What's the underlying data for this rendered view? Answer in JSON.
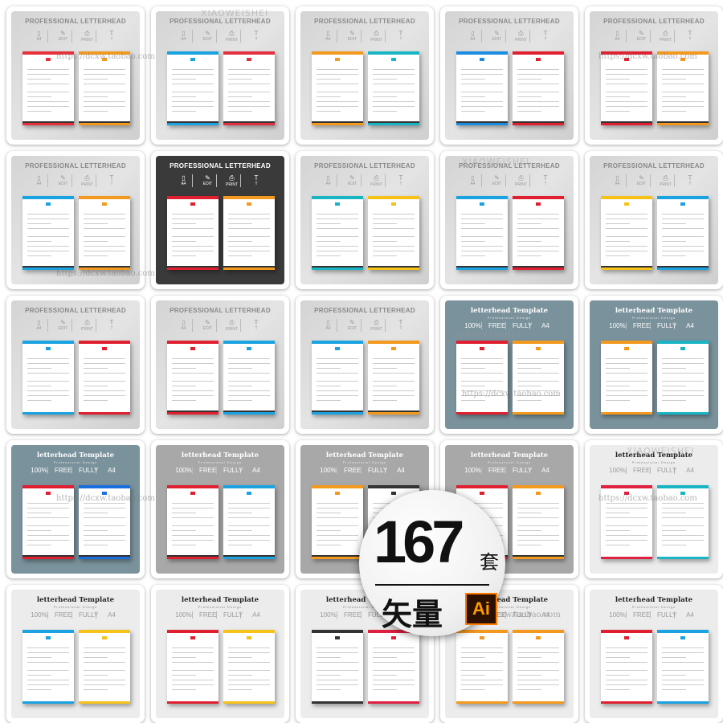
{
  "watermark": {
    "url": "https://dcxw.taobao.com",
    "brand": "XIAOWEISHEI"
  },
  "header_variants": {
    "pro": {
      "title": "PROFESSIONAL LETTERHEAD",
      "icons": [
        {
          "icon": "document-icon",
          "label": "A4"
        },
        {
          "icon": "pencil-icon",
          "label": "EDIT"
        },
        {
          "icon": "printer-icon",
          "label": "PRINT"
        },
        {
          "icon": "font-icon",
          "label": "T"
        }
      ]
    },
    "tpl": {
      "title": "letterhead Template",
      "subtitle": "Professional Design",
      "badges": [
        "100%",
        "FREE",
        "FULLY",
        "A4"
      ]
    }
  },
  "tiles": [
    {
      "variant": "pro",
      "bg": "light",
      "a": "#e8303a",
      "b": "#f39a1e",
      "foot": "#333"
    },
    {
      "variant": "pro",
      "bg": "light",
      "a": "#1aa3e0",
      "b": "#e23040",
      "foot": "#333"
    },
    {
      "variant": "pro",
      "bg": "light",
      "a": "#f39a1e",
      "b": "#1ab5c4",
      "foot": "#333"
    },
    {
      "variant": "pro",
      "bg": "light",
      "a": "#1a8de0",
      "b": "#e02030",
      "foot": "#333"
    },
    {
      "variant": "pro",
      "bg": "light",
      "a": "#e02030",
      "b": "#f39a1e",
      "foot": "#333"
    },
    {
      "variant": "pro",
      "bg": "light",
      "a": "#1aa3e0",
      "b": "#f39a1e",
      "foot": "#333"
    },
    {
      "variant": "pro",
      "bg": "dark",
      "a": "#e02030",
      "b": "#f39a1e",
      "foot": "#333"
    },
    {
      "variant": "pro",
      "bg": "light",
      "a": "#1ab5c4",
      "b": "#f5c21a",
      "foot": "#333"
    },
    {
      "variant": "pro",
      "bg": "light",
      "a": "#1aa3e0",
      "b": "#e02030",
      "foot": "#333"
    },
    {
      "variant": "pro",
      "bg": "light",
      "a": "#f5c21a",
      "b": "#1aa3e0",
      "foot": "#333"
    },
    {
      "variant": "pro",
      "bg": "light",
      "a": "#1aa3e0",
      "b": "#e02030",
      "foot": "#fff"
    },
    {
      "variant": "pro",
      "bg": "light",
      "a": "#e02030",
      "b": "#1aa3e0",
      "foot": "#333"
    },
    {
      "variant": "pro",
      "bg": "light",
      "a": "#1aa3e0",
      "b": "#f39a1e",
      "foot": "#333"
    },
    {
      "variant": "tpl",
      "bg": "slate",
      "a": "#e02030",
      "b": "#f39a1e",
      "foot": "#fff"
    },
    {
      "variant": "tpl",
      "bg": "slate",
      "a": "#f39a1e",
      "b": "#1ab5c4",
      "foot": "#fff"
    },
    {
      "variant": "tpl",
      "bg": "slate",
      "a": "#e02030",
      "b": "#1a6fe0",
      "foot": "#333"
    },
    {
      "variant": "tpl",
      "bg": "grey",
      "a": "#e02030",
      "b": "#1aa3e0",
      "foot": "#333"
    },
    {
      "variant": "tpl",
      "bg": "grey",
      "a": "#f39a1e",
      "b": "#333",
      "foot": "#333"
    },
    {
      "variant": "tpl",
      "bg": "grey",
      "a": "#e02030",
      "b": "#f39a1e",
      "foot": "#333"
    },
    {
      "variant": "tpl",
      "bg": "white",
      "a": "#e02040",
      "b": "#1ab5c4",
      "foot": "#fff"
    },
    {
      "variant": "tpl",
      "bg": "white",
      "a": "#1aa3e0",
      "b": "#f5c21a",
      "foot": "#fff"
    },
    {
      "variant": "tpl",
      "bg": "white",
      "a": "#e02030",
      "b": "#f5c21a",
      "foot": "#fff"
    },
    {
      "variant": "tpl",
      "bg": "white",
      "a": "#333",
      "b": "#e02040",
      "foot": "#fff"
    },
    {
      "variant": "tpl",
      "bg": "white",
      "a": "#f39a1e",
      "b": "#f39a1e",
      "foot": "#fff"
    },
    {
      "variant": "tpl",
      "bg": "white",
      "a": "#e02030",
      "b": "#1aa3e0",
      "foot": "#fff"
    }
  ],
  "badge": {
    "count": "167",
    "unit": "套",
    "label": "矢量",
    "format": "Ai",
    "format_color": "#ff7c00"
  }
}
